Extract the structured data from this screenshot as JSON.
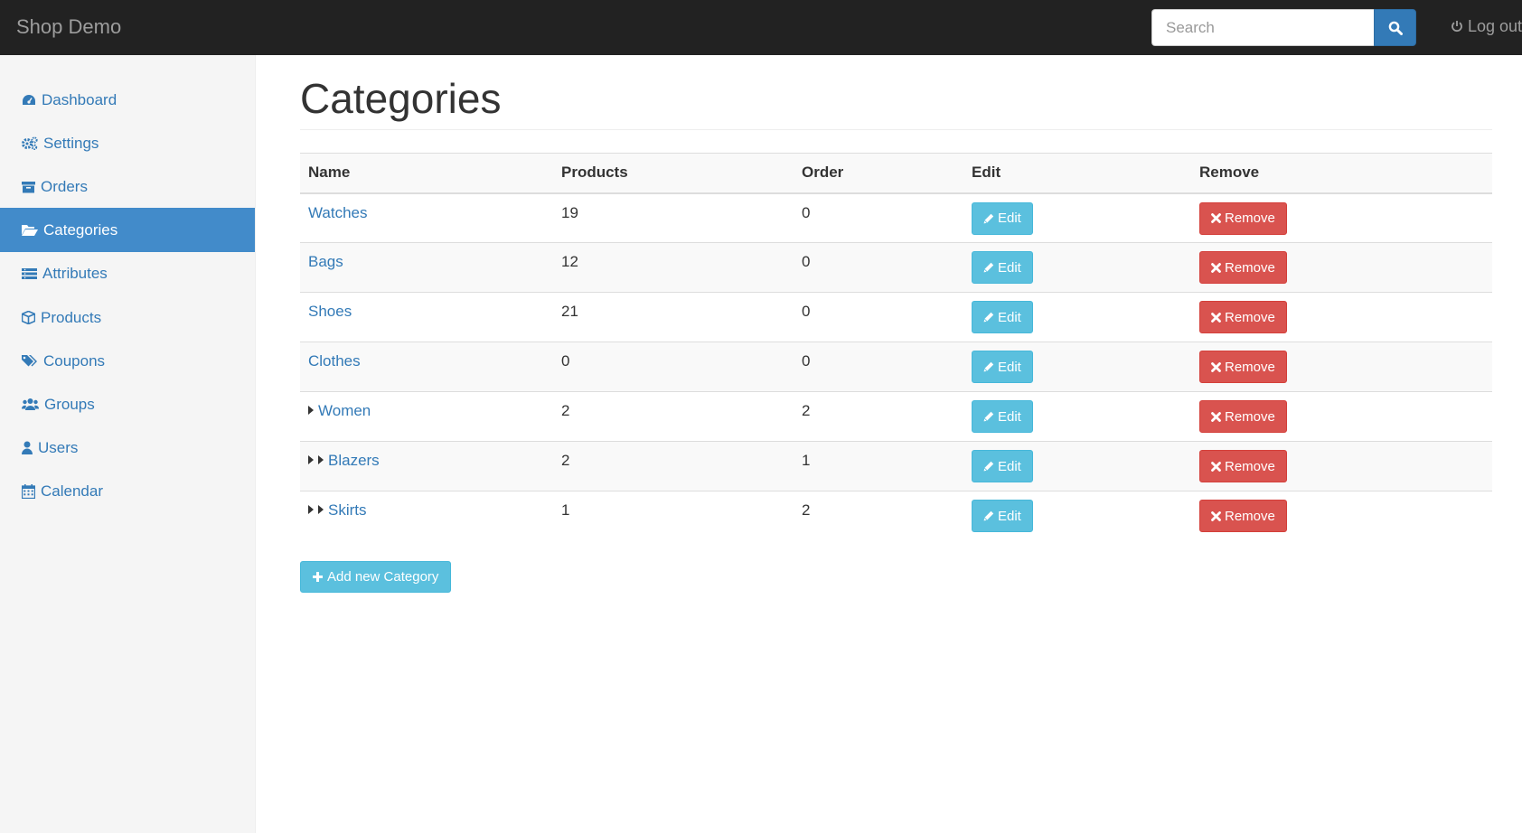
{
  "app": {
    "brand": "Shop Demo"
  },
  "header": {
    "search_placeholder": "Search",
    "logout_label": "Log out"
  },
  "sidebar": {
    "items": [
      {
        "label": "Dashboard",
        "icon": "dashboard-icon"
      },
      {
        "label": "Settings",
        "icon": "gears-icon"
      },
      {
        "label": "Orders",
        "icon": "archive-icon"
      },
      {
        "label": "Categories",
        "icon": "folder-open-icon",
        "active": true
      },
      {
        "label": "Attributes",
        "icon": "list-icon"
      },
      {
        "label": "Products",
        "icon": "cube-icon"
      },
      {
        "label": "Coupons",
        "icon": "tags-icon"
      },
      {
        "label": "Groups",
        "icon": "users-icon"
      },
      {
        "label": "Users",
        "icon": "user-icon"
      },
      {
        "label": "Calendar",
        "icon": "calendar-icon"
      }
    ]
  },
  "main": {
    "title": "Categories",
    "table": {
      "headers": [
        "Name",
        "Products",
        "Order",
        "Edit",
        "Remove"
      ],
      "rows": [
        {
          "name": "Watches",
          "level": 0,
          "products": "19",
          "order": "0"
        },
        {
          "name": "Bags",
          "level": 0,
          "products": "12",
          "order": "0"
        },
        {
          "name": "Shoes",
          "level": 0,
          "products": "21",
          "order": "0"
        },
        {
          "name": "Clothes",
          "level": 0,
          "products": "0",
          "order": "0"
        },
        {
          "name": "Women",
          "level": 1,
          "products": "2",
          "order": "2"
        },
        {
          "name": "Blazers",
          "level": 2,
          "products": "2",
          "order": "1"
        },
        {
          "name": "Skirts",
          "level": 2,
          "products": "1",
          "order": "2"
        }
      ],
      "edit_label": "Edit",
      "remove_label": "Remove"
    },
    "add_button_label": "Add new Category"
  },
  "colors": {
    "navbar": "#222222",
    "link": "#337ab7",
    "active_nav": "#428bca",
    "info": "#5bc0de",
    "danger": "#d9534f"
  }
}
